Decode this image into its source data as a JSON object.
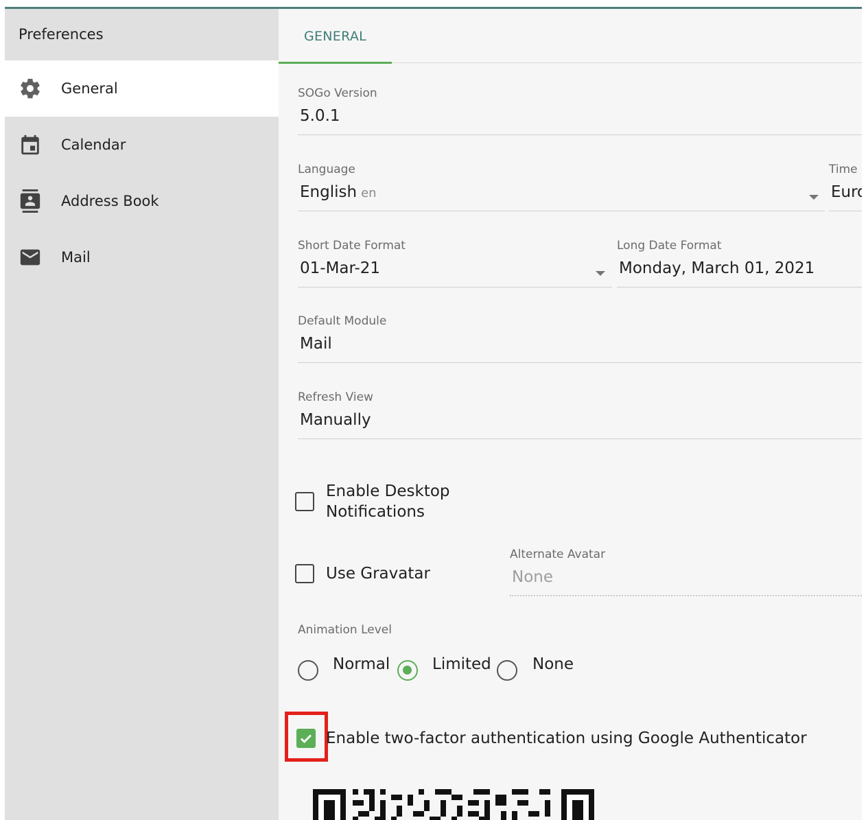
{
  "sidebar": {
    "title": "Preferences",
    "items": [
      {
        "label": "General",
        "icon": "gear-icon",
        "active": true
      },
      {
        "label": "Calendar",
        "icon": "calendar-icon",
        "active": false
      },
      {
        "label": "Address Book",
        "icon": "contact-card-icon",
        "active": false
      },
      {
        "label": "Mail",
        "icon": "mail-icon",
        "active": false
      }
    ]
  },
  "tabs": [
    {
      "label": "GENERAL"
    }
  ],
  "form": {
    "sogo_version": {
      "label": "SOGo Version",
      "value": "5.0.1"
    },
    "language": {
      "label": "Language",
      "value": "English",
      "code": "en"
    },
    "timezone": {
      "label": "Time",
      "value": "Euro"
    },
    "short_date": {
      "label": "Short Date Format",
      "value": "01-Mar-21"
    },
    "long_date": {
      "label": "Long Date Format",
      "value": "Monday, March 01, 2021"
    },
    "default_module": {
      "label": "Default Module",
      "value": "Mail"
    },
    "refresh_view": {
      "label": "Refresh View",
      "value": "Manually"
    },
    "desktop_notifications": {
      "label_line1": "Enable Desktop",
      "label_line2": "Notifications",
      "checked": false
    },
    "gravatar": {
      "label": "Use Gravatar",
      "checked": false
    },
    "alternate_avatar": {
      "label": "Alternate Avatar",
      "value": "None"
    },
    "animation": {
      "label": "Animation Level",
      "options": [
        "Normal",
        "Limited",
        "None"
      ],
      "selected": "Limited"
    },
    "two_factor": {
      "label": "Enable two-factor authentication using Google Authenticator",
      "checked": true
    }
  },
  "colors": {
    "accent": "#5cae57",
    "teal": "#3f7c77",
    "highlight": "#e3201b"
  }
}
